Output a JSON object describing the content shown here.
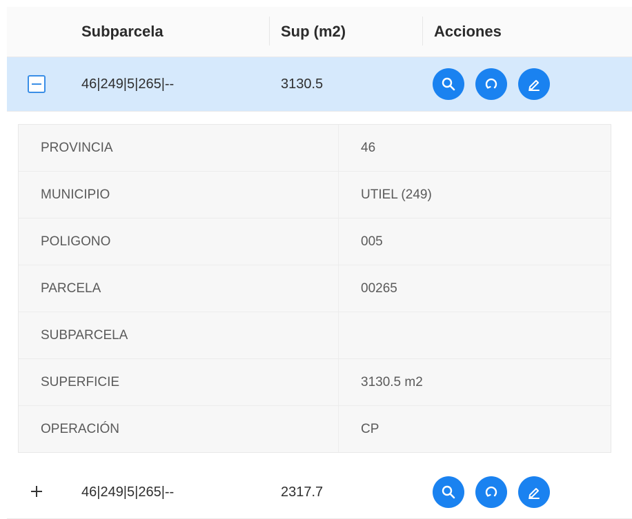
{
  "columns": {
    "subparcela": "Subparcela",
    "superficie": "Sup (m2)",
    "acciones": "Acciones"
  },
  "rows": [
    {
      "subparcela": "46|249|5|265|--",
      "superficie": "3130.5",
      "expanded": true
    },
    {
      "subparcela": "46|249|5|265|--",
      "superficie": "2317.7",
      "expanded": false
    }
  ],
  "detail": [
    {
      "label": "PROVINCIA",
      "value": "46"
    },
    {
      "label": "MUNICIPIO",
      "value": "UTIEL (249)"
    },
    {
      "label": "POLIGONO",
      "value": "005"
    },
    {
      "label": "PARCELA",
      "value": "00265"
    },
    {
      "label": "SUBPARCELA",
      "value": ""
    },
    {
      "label": "SUPERFICIE",
      "value": "3130.5 m2"
    },
    {
      "label": "OPERACIÓN",
      "value": "CP"
    }
  ],
  "icons": {
    "search": "search-icon",
    "refresh": "refresh-icon",
    "edit": "edit-icon"
  },
  "colors": {
    "accent": "#1a82f0",
    "selected_row": "#d6e9fc"
  }
}
